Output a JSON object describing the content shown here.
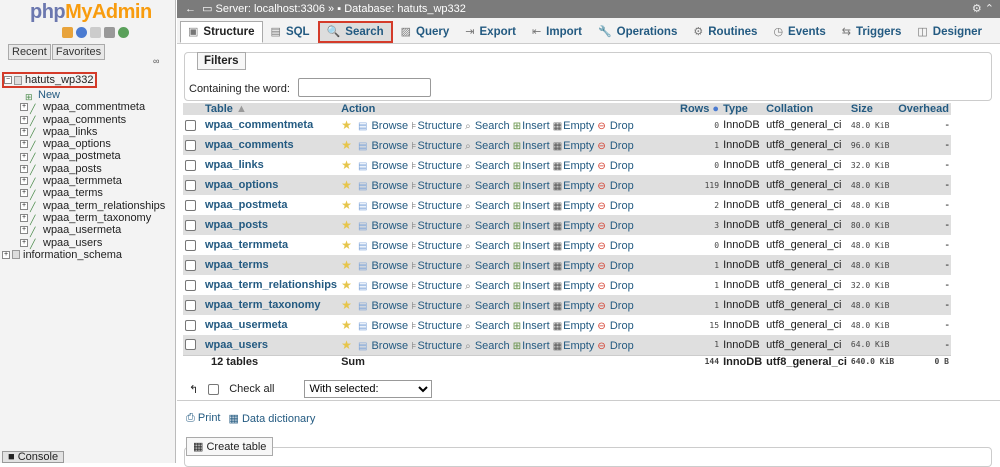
{
  "sidebar": {
    "logo_php": "php",
    "logo_my": "MyAdmin",
    "recent": "Recent",
    "favorites": "Favorites",
    "db_name": "hatuts_wp332",
    "new_label": "New",
    "tables": [
      "wpaa_commentmeta",
      "wpaa_comments",
      "wpaa_links",
      "wpaa_options",
      "wpaa_postmeta",
      "wpaa_posts",
      "wpaa_termmeta",
      "wpaa_terms",
      "wpaa_term_relationships",
      "wpaa_term_taxonomy",
      "wpaa_usermeta",
      "wpaa_users"
    ],
    "other_db": "information_schema"
  },
  "breadcrumb": {
    "server": "Server: localhost:3306",
    "sep": "»",
    "db": "Database: hatuts_wp332"
  },
  "menu": [
    "Structure",
    "SQL",
    "Search",
    "Query",
    "Export",
    "Import",
    "Operations",
    "Routines",
    "Events",
    "Triggers",
    "Designer"
  ],
  "filters": {
    "legend": "Filters",
    "label": "Containing the word:",
    "value": ""
  },
  "table_headers": {
    "table": "Table",
    "action": "Action",
    "rows": "Rows",
    "type": "Type",
    "collation": "Collation",
    "size": "Size",
    "overhead": "Overhead"
  },
  "actions": {
    "browse": "Browse",
    "structure": "Structure",
    "search": "Search",
    "insert": "Insert",
    "empty": "Empty",
    "drop": "Drop"
  },
  "rows": [
    {
      "name": "wpaa_commentmeta",
      "rows": "0",
      "type": "InnoDB",
      "collation": "utf8_general_ci",
      "size": "48.0 KiB",
      "overhead": "-"
    },
    {
      "name": "wpaa_comments",
      "rows": "1",
      "type": "InnoDB",
      "collation": "utf8_general_ci",
      "size": "96.0 KiB",
      "overhead": "-"
    },
    {
      "name": "wpaa_links",
      "rows": "0",
      "type": "InnoDB",
      "collation": "utf8_general_ci",
      "size": "32.0 KiB",
      "overhead": "-"
    },
    {
      "name": "wpaa_options",
      "rows": "119",
      "type": "InnoDB",
      "collation": "utf8_general_ci",
      "size": "48.0 KiB",
      "overhead": "-"
    },
    {
      "name": "wpaa_postmeta",
      "rows": "2",
      "type": "InnoDB",
      "collation": "utf8_general_ci",
      "size": "48.0 KiB",
      "overhead": "-"
    },
    {
      "name": "wpaa_posts",
      "rows": "3",
      "type": "InnoDB",
      "collation": "utf8_general_ci",
      "size": "80.0 KiB",
      "overhead": "-"
    },
    {
      "name": "wpaa_termmeta",
      "rows": "0",
      "type": "InnoDB",
      "collation": "utf8_general_ci",
      "size": "48.0 KiB",
      "overhead": "-"
    },
    {
      "name": "wpaa_terms",
      "rows": "1",
      "type": "InnoDB",
      "collation": "utf8_general_ci",
      "size": "48.0 KiB",
      "overhead": "-"
    },
    {
      "name": "wpaa_term_relationships",
      "rows": "1",
      "type": "InnoDB",
      "collation": "utf8_general_ci",
      "size": "32.0 KiB",
      "overhead": "-"
    },
    {
      "name": "wpaa_term_taxonomy",
      "rows": "1",
      "type": "InnoDB",
      "collation": "utf8_general_ci",
      "size": "48.0 KiB",
      "overhead": "-"
    },
    {
      "name": "wpaa_usermeta",
      "rows": "15",
      "type": "InnoDB",
      "collation": "utf8_general_ci",
      "size": "48.0 KiB",
      "overhead": "-"
    },
    {
      "name": "wpaa_users",
      "rows": "1",
      "type": "InnoDB",
      "collation": "utf8_general_ci",
      "size": "64.0 KiB",
      "overhead": "-"
    }
  ],
  "footer": {
    "count": "12 tables",
    "sum": "Sum",
    "rows": "144",
    "type": "InnoDB",
    "collation": "utf8_general_ci",
    "size": "640.0 KiB",
    "overhead": "0 B"
  },
  "bottom": {
    "check_all": "Check all",
    "with_selected": "With selected:",
    "print": "Print",
    "data_dictionary": "Data dictionary",
    "create_table": "Create table",
    "console": "Console"
  }
}
